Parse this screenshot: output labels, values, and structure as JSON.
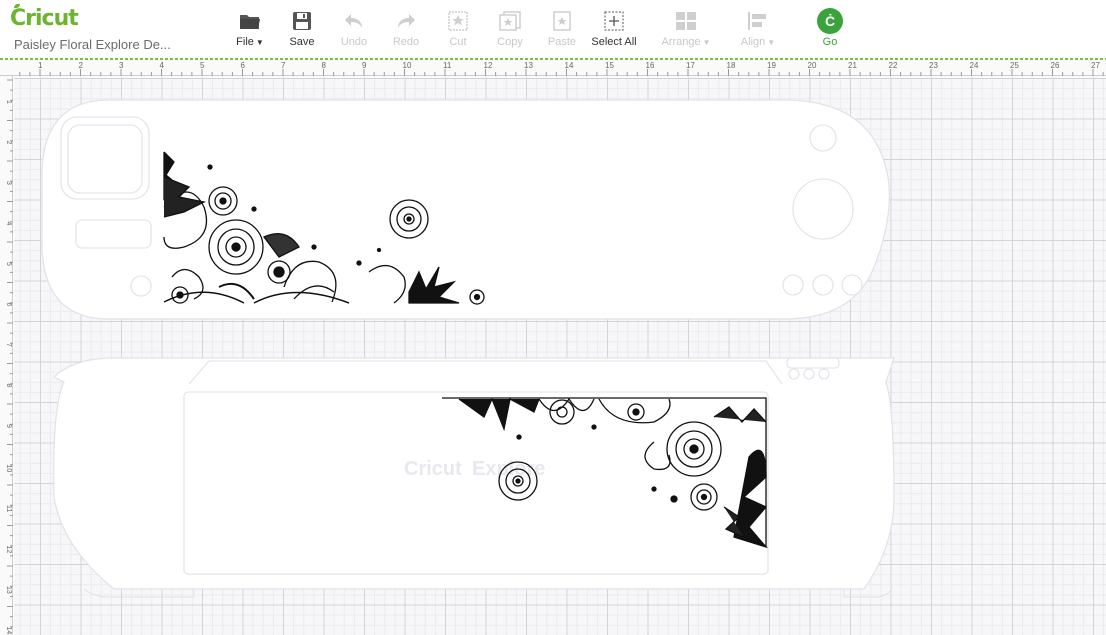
{
  "app": {
    "brand": "Cricut",
    "project_name": "Paisley Floral Explore De..."
  },
  "toolbar": {
    "file": "File",
    "save": "Save",
    "undo": "Undo",
    "redo": "Redo",
    "cut": "Cut",
    "copy": "Copy",
    "paste": "Paste",
    "select_all": "Select All",
    "arrange": "Arrange",
    "align": "Align",
    "go": "Go",
    "go_icon_glyph": "Ċ"
  },
  "colors": {
    "brand_green": "#6ab42e",
    "go_green": "#3aa33b",
    "disabled": "#c8c8c8"
  },
  "rulers": {
    "horizontal": [
      "1",
      "2",
      "3",
      "4",
      "5",
      "6",
      "7",
      "8",
      "9",
      "10",
      "11",
      "12",
      "13",
      "14",
      "15",
      "16",
      "17",
      "18",
      "19",
      "20",
      "21",
      "22",
      "23",
      "24",
      "25",
      "26",
      "27"
    ],
    "vertical": [
      "1",
      "2",
      "3",
      "4",
      "5",
      "6",
      "7",
      "8",
      "9",
      "10",
      "11",
      "12",
      "13",
      "14"
    ]
  },
  "canvas": {
    "watermark_brand": "Cricut",
    "watermark_model": "Explore"
  }
}
